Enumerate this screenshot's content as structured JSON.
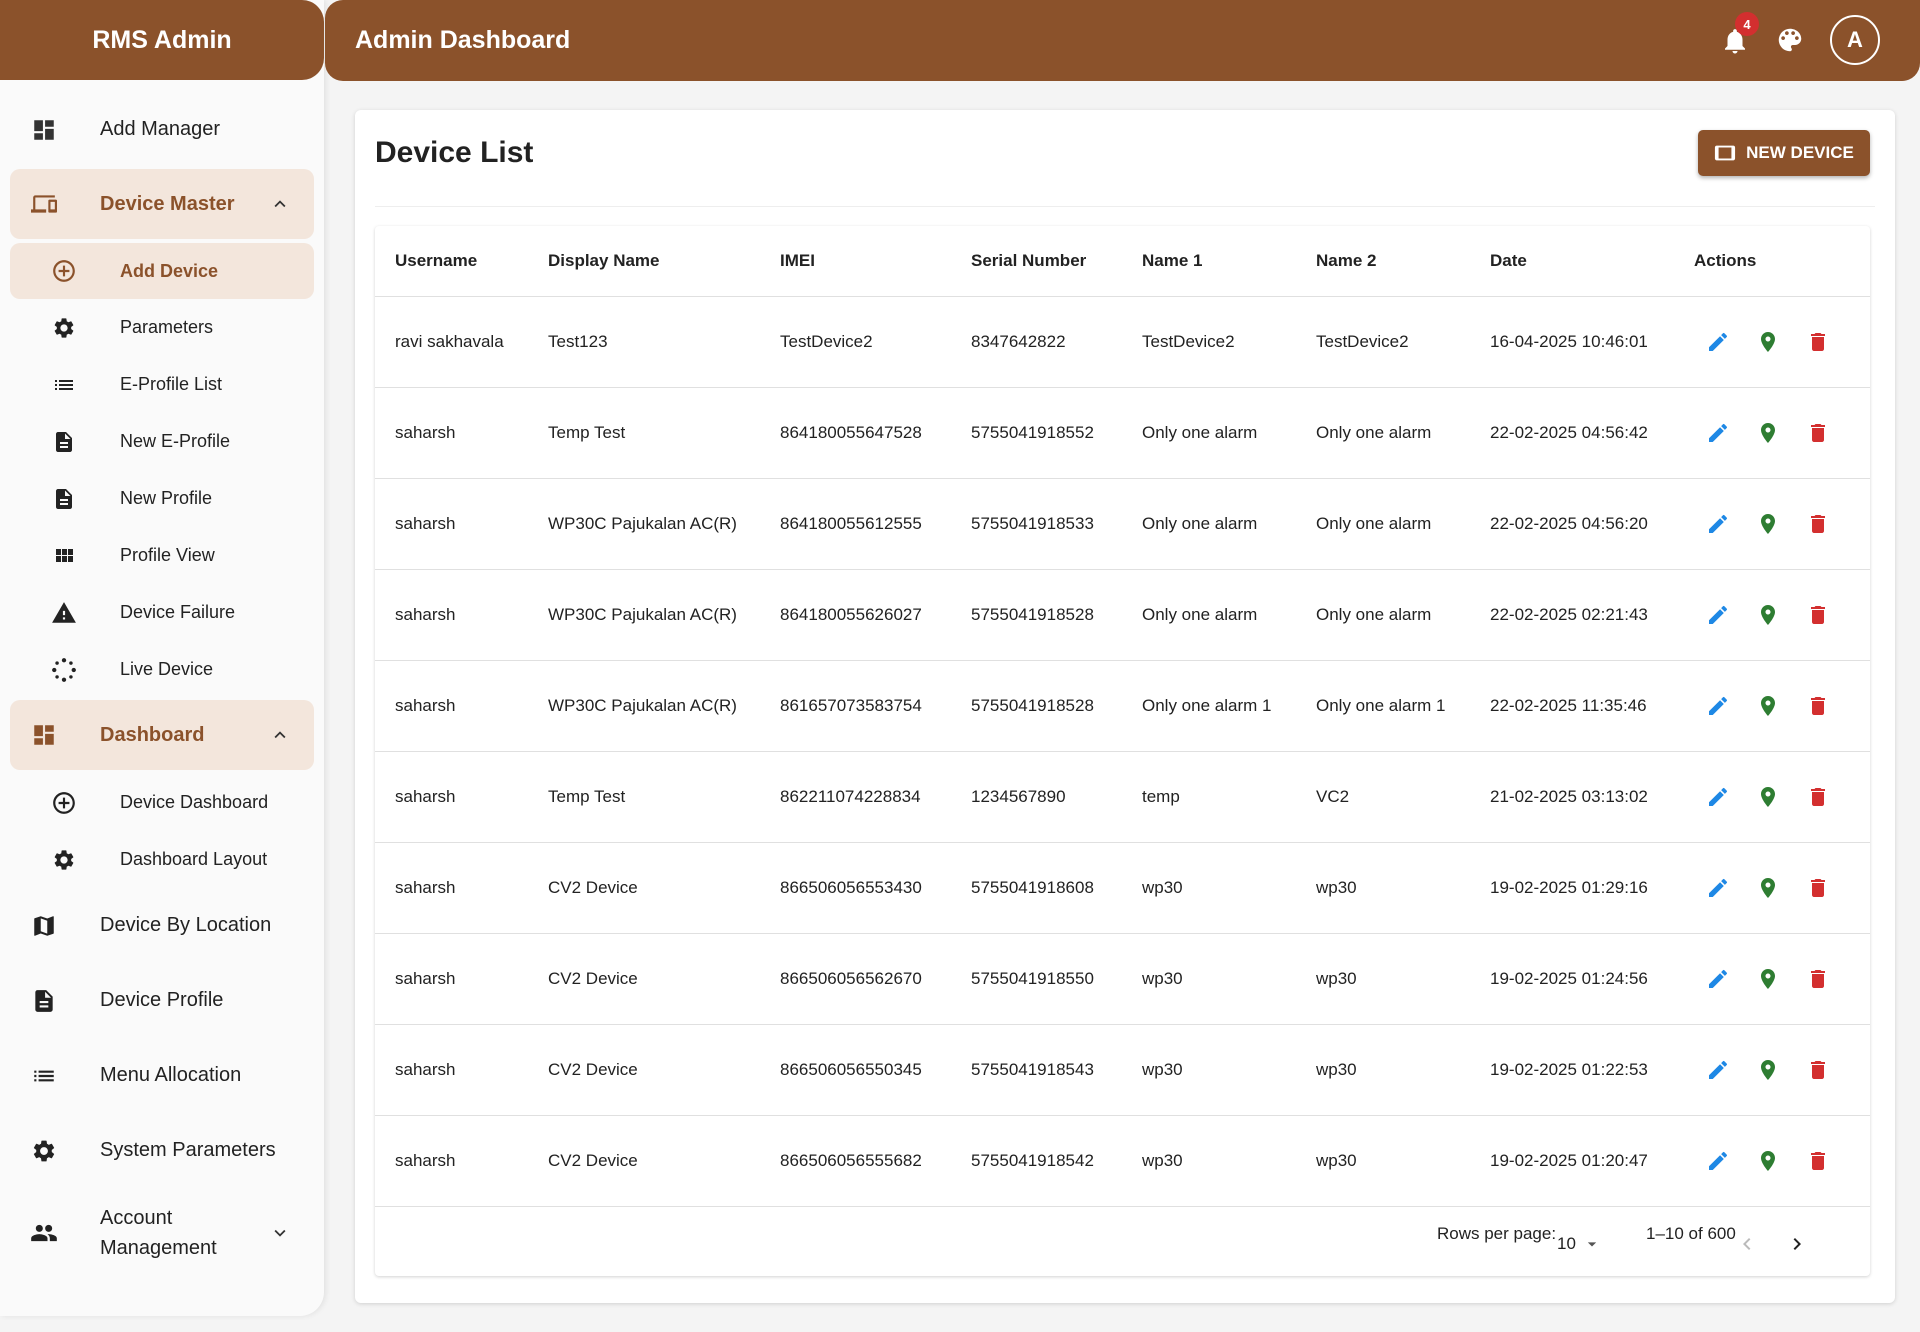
{
  "app": {
    "brand": "RMS Admin",
    "title": "Admin Dashboard",
    "notification_count": "4",
    "avatar_initial": "A"
  },
  "sidebar": {
    "add_manager": "Add Manager",
    "device_master": "Device Master",
    "device_master_items": [
      "Add Device",
      "Parameters",
      "E-Profile List",
      "New E-Profile",
      "New Profile",
      "Profile View",
      "Device Failure",
      "Live Device"
    ],
    "dashboard": "Dashboard",
    "dashboard_items": [
      "Device Dashboard",
      "Dashboard Layout"
    ],
    "device_by_location": "Device By Location",
    "device_profile": "Device Profile",
    "menu_allocation": "Menu Allocation",
    "system_parameters": "System Parameters",
    "account_management_line1": "Account",
    "account_management_line2": "Management"
  },
  "main": {
    "title": "Device List",
    "new_device_label": "NEW DEVICE",
    "columns": [
      "Username",
      "Display Name",
      "IMEI",
      "Serial Number",
      "Name 1",
      "Name 2",
      "Date",
      "Actions"
    ],
    "rows": [
      [
        "ravi sakhavala",
        "Test123",
        "TestDevice2",
        "8347642822",
        "TestDevice2",
        "TestDevice2",
        "16-04-2025 10:46:01"
      ],
      [
        "saharsh",
        "Temp Test",
        "864180055647528",
        "5755041918552",
        "Only one alarm",
        "Only one alarm",
        "22-02-2025 04:56:42"
      ],
      [
        "saharsh",
        "WP30C Pajukalan AC(R)",
        "864180055612555",
        "5755041918533",
        "Only one alarm",
        "Only one alarm",
        "22-02-2025 04:56:20"
      ],
      [
        "saharsh",
        "WP30C Pajukalan AC(R)",
        "864180055626027",
        "5755041918528",
        "Only one alarm",
        "Only one alarm",
        "22-02-2025 02:21:43"
      ],
      [
        "saharsh",
        "WP30C Pajukalan AC(R)",
        "861657073583754",
        "5755041918528",
        "Only one alarm 1",
        "Only one alarm 1",
        "22-02-2025 11:35:46"
      ],
      [
        "saharsh",
        "Temp Test",
        "862211074228834",
        "1234567890",
        "temp",
        "VC2",
        "21-02-2025 03:13:02"
      ],
      [
        "saharsh",
        "CV2 Device",
        "866506056553430",
        "5755041918608",
        "wp30",
        "wp30",
        "19-02-2025 01:29:16"
      ],
      [
        "saharsh",
        "CV2 Device",
        "866506056562670",
        "5755041918550",
        "wp30",
        "wp30",
        "19-02-2025 01:24:56"
      ],
      [
        "saharsh",
        "CV2 Device",
        "866506056550345",
        "5755041918543",
        "wp30",
        "wp30",
        "19-02-2025 01:22:53"
      ],
      [
        "saharsh",
        "CV2 Device",
        "866506056555682",
        "5755041918542",
        "wp30",
        "wp30",
        "19-02-2025 01:20:47"
      ]
    ],
    "pagination": {
      "rows_per_page_label": "Rows per page:",
      "rows_per_page_value": "10",
      "range": "1–10 of 600"
    }
  },
  "colors": {
    "brand": "#8b522b",
    "active_bg": "#f3e6dc",
    "edit": "#1e88e5",
    "location": "#2e7d32",
    "delete": "#d32f2f"
  }
}
